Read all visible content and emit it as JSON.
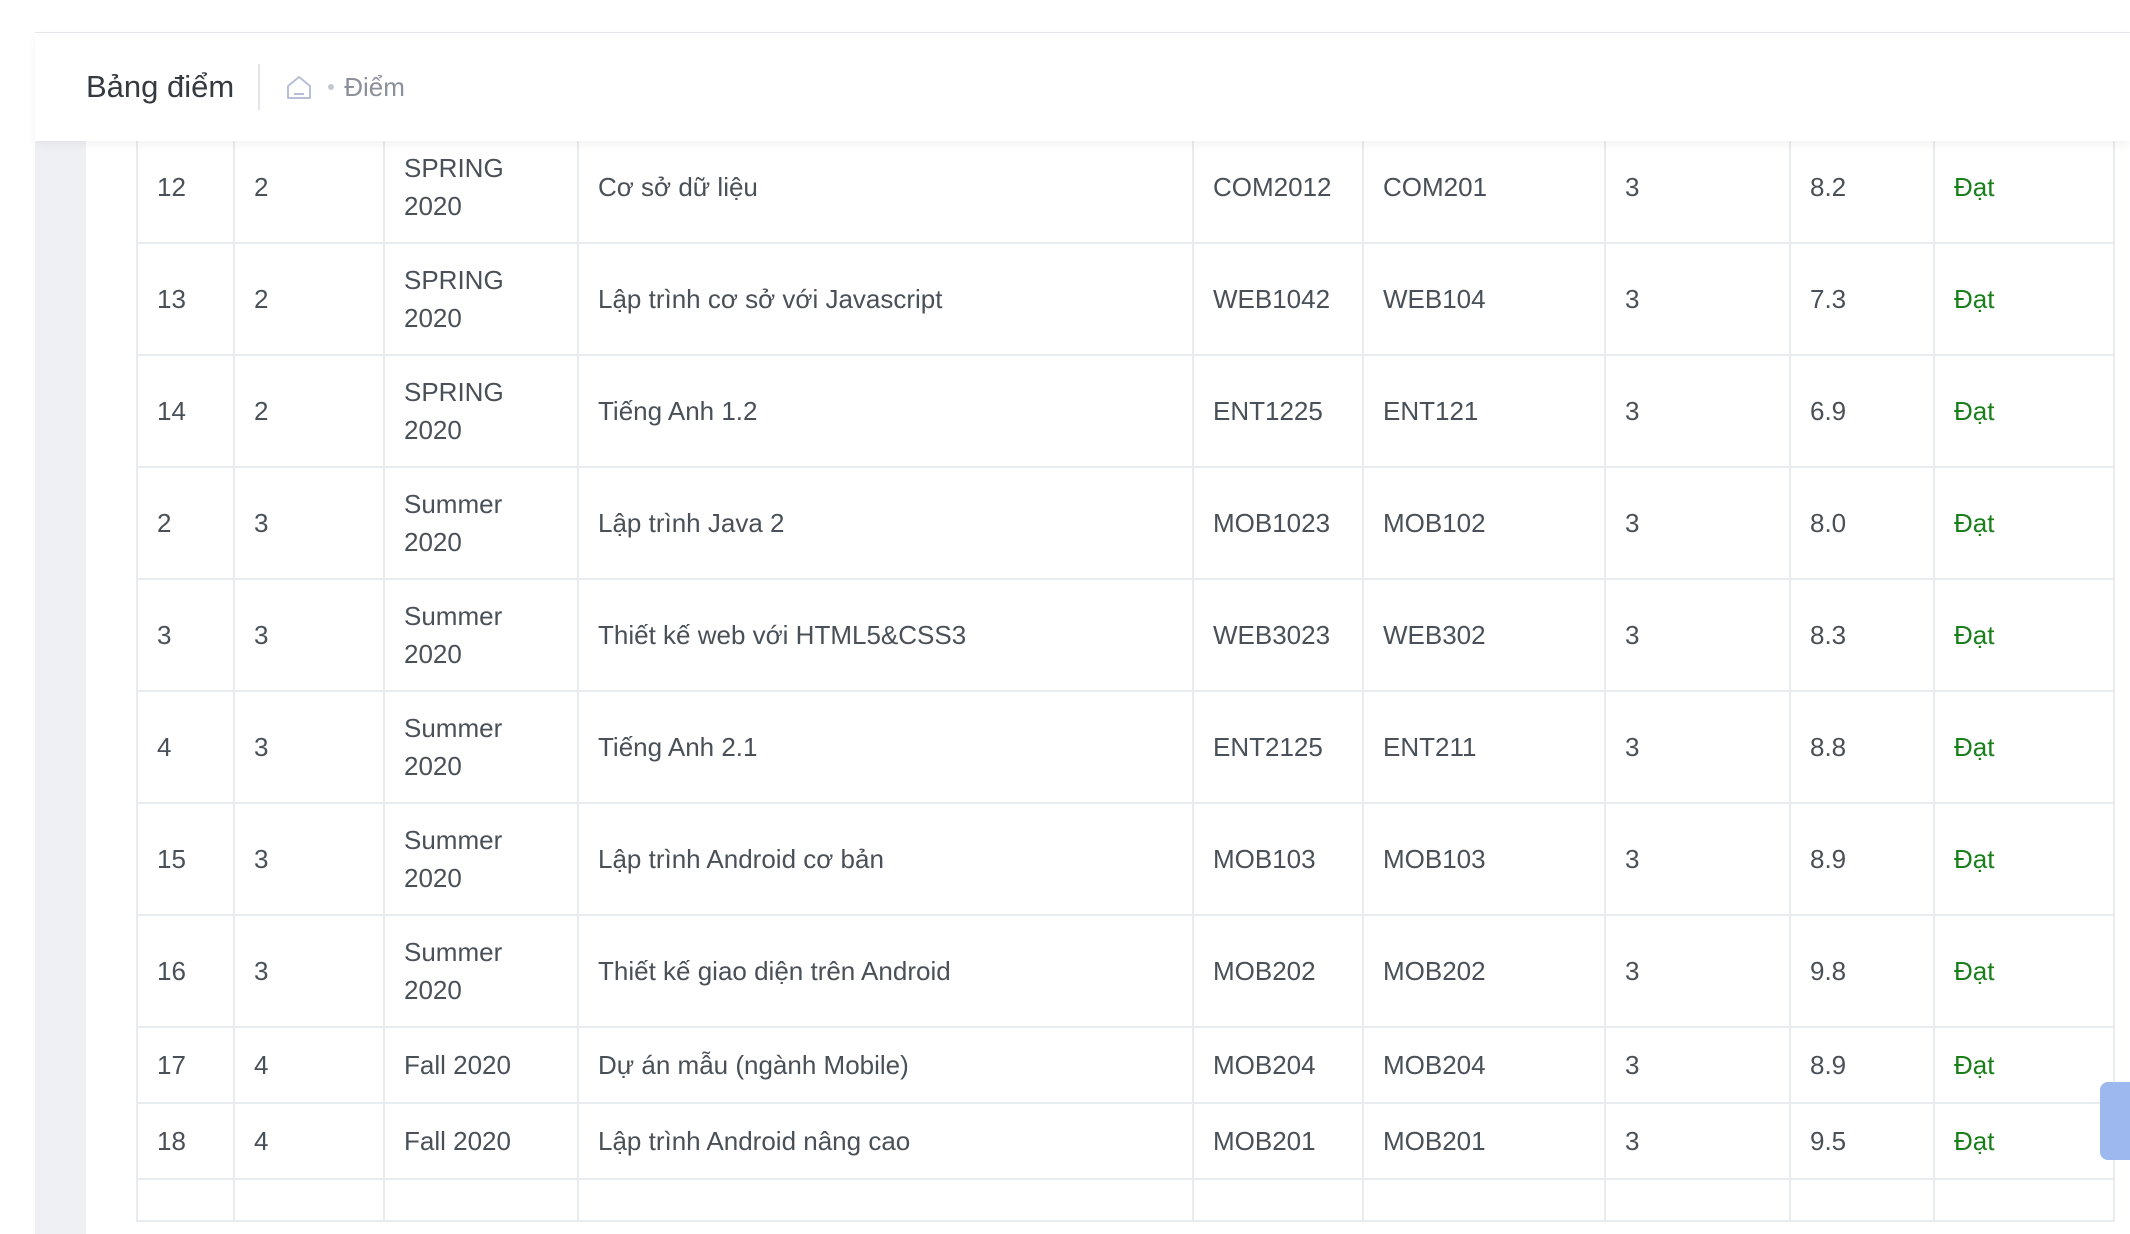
{
  "header": {
    "title": "Bảng điểm",
    "breadcrumb": [
      "Điểm"
    ]
  },
  "table": {
    "rows": [
      {
        "stt": "12",
        "ky": "2",
        "hoc_ky": "SPRING 2020",
        "mon": "Cơ sở dữ liệu",
        "ma_mon": "COM2012",
        "ma_chuyen_doi": "COM201",
        "tin_chi": "3",
        "diem": "8.2",
        "trang_thai": "Đạt"
      },
      {
        "stt": "13",
        "ky": "2",
        "hoc_ky": "SPRING 2020",
        "mon": "Lập trình cơ sở với Javascript",
        "ma_mon": "WEB1042",
        "ma_chuyen_doi": "WEB104",
        "tin_chi": "3",
        "diem": "7.3",
        "trang_thai": "Đạt"
      },
      {
        "stt": "14",
        "ky": "2",
        "hoc_ky": "SPRING 2020",
        "mon": "Tiếng Anh 1.2",
        "ma_mon": "ENT1225",
        "ma_chuyen_doi": "ENT121",
        "tin_chi": "3",
        "diem": "6.9",
        "trang_thai": "Đạt"
      },
      {
        "stt": "2",
        "ky": "3",
        "hoc_ky": "Summer 2020",
        "mon": "Lập trình Java 2",
        "ma_mon": "MOB1023",
        "ma_chuyen_doi": "MOB102",
        "tin_chi": "3",
        "diem": "8.0",
        "trang_thai": "Đạt"
      },
      {
        "stt": "3",
        "ky": "3",
        "hoc_ky": "Summer 2020",
        "mon": "Thiết kế web với HTML5&CSS3",
        "ma_mon": "WEB3023",
        "ma_chuyen_doi": "WEB302",
        "tin_chi": "3",
        "diem": "8.3",
        "trang_thai": "Đạt"
      },
      {
        "stt": "4",
        "ky": "3",
        "hoc_ky": "Summer 2020",
        "mon": "Tiếng Anh 2.1",
        "ma_mon": "ENT2125",
        "ma_chuyen_doi": "ENT211",
        "tin_chi": "3",
        "diem": "8.8",
        "trang_thai": "Đạt"
      },
      {
        "stt": "15",
        "ky": "3",
        "hoc_ky": "Summer 2020",
        "mon": "Lập trình Android cơ bản",
        "ma_mon": "MOB103",
        "ma_chuyen_doi": "MOB103",
        "tin_chi": "3",
        "diem": "8.9",
        "trang_thai": "Đạt"
      },
      {
        "stt": "16",
        "ky": "3",
        "hoc_ky": "Summer 2020",
        "mon": "Thiết kế giao diện trên Android",
        "ma_mon": "MOB202",
        "ma_chuyen_doi": "MOB202",
        "tin_chi": "3",
        "diem": "9.8",
        "trang_thai": "Đạt"
      },
      {
        "stt": "17",
        "ky": "4",
        "hoc_ky": "Fall 2020",
        "mon": "Dự án mẫu (ngành Mobile)",
        "ma_mon": "MOB204",
        "ma_chuyen_doi": "MOB204",
        "tin_chi": "3",
        "diem": "8.9",
        "trang_thai": "Đạt"
      },
      {
        "stt": "18",
        "ky": "4",
        "hoc_ky": "Fall 2020",
        "mon": "Lập trình Android nâng cao",
        "ma_mon": "MOB201",
        "ma_chuyen_doi": "MOB201",
        "tin_chi": "3",
        "diem": "9.5",
        "trang_thai": "Đạt"
      }
    ]
  },
  "colors": {
    "status_pass": "#1a7f1a",
    "page_background": "#eff0f4",
    "border": "#e9ecef"
  },
  "icons": {
    "home": "home-icon"
  }
}
